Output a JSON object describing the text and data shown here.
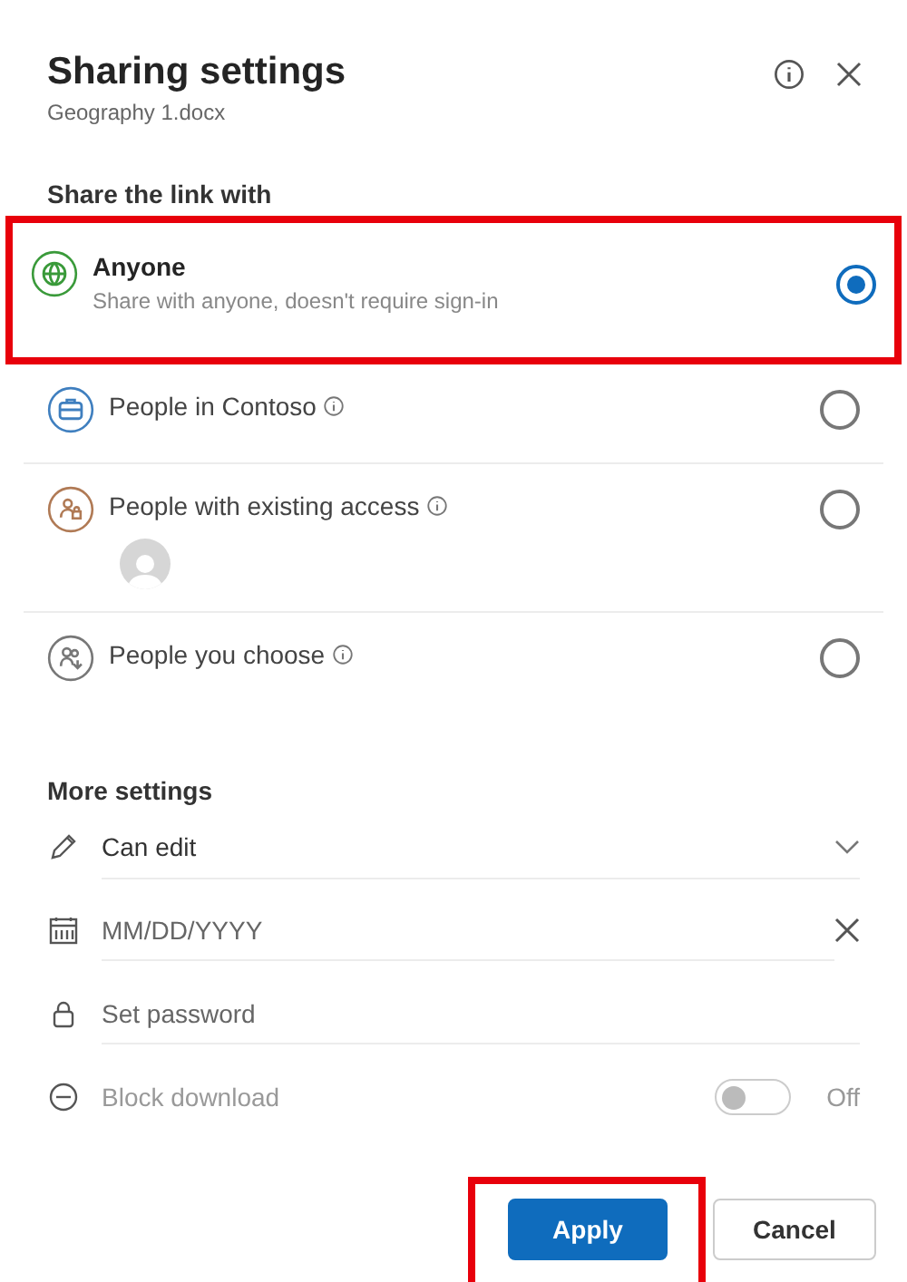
{
  "header": {
    "title": "Sharing settings",
    "subtitle": "Geography 1.docx"
  },
  "share_section": {
    "heading": "Share the link with",
    "options": [
      {
        "label": "Anyone",
        "description": "Share with anyone, doesn't require sign-in",
        "info": false,
        "avatar": false,
        "selected": true,
        "highlighted": true,
        "color": "#3a9a3a"
      },
      {
        "label": "People in Contoso",
        "info": true,
        "avatar": false,
        "selected": false,
        "highlighted": false,
        "color": "#3f7fbf"
      },
      {
        "label": "People with existing access",
        "info": true,
        "avatar": true,
        "selected": false,
        "highlighted": false,
        "color": "#b07a55"
      },
      {
        "label": "People you choose",
        "info": true,
        "avatar": false,
        "selected": false,
        "highlighted": false,
        "color": "#777777"
      }
    ]
  },
  "more_settings": {
    "heading": "More settings",
    "items": [
      {
        "kind": "dropdown",
        "value": "Can edit",
        "disabled": false
      },
      {
        "kind": "date",
        "placeholder": "MM/DD/YYYY",
        "disabled": false
      },
      {
        "kind": "password",
        "placeholder": "Set password",
        "disabled": false
      },
      {
        "kind": "toggle",
        "label": "Block download",
        "on": false,
        "state": "Off",
        "disabled": true
      }
    ]
  },
  "buttons": [
    {
      "label": "Apply",
      "primary": true,
      "highlighted": true
    },
    {
      "label": "Cancel",
      "primary": false,
      "highlighted": false
    }
  ]
}
